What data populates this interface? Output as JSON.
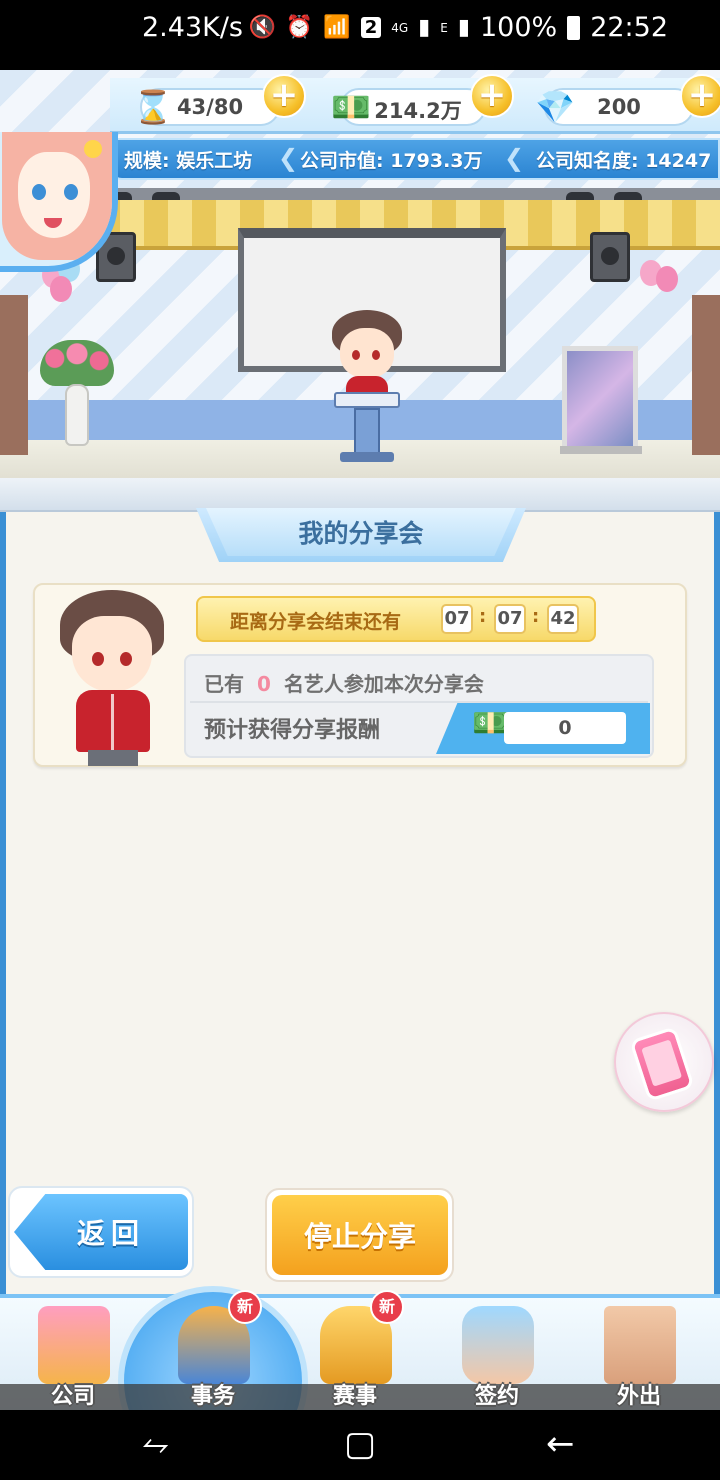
{
  "status_bar": {
    "speed": "2.43K/s",
    "sim_badge": "2",
    "net1": "4G",
    "net2": "E",
    "battery": "100%",
    "time": "22:52"
  },
  "hud": {
    "energy": "43/80",
    "cash": "214.2万",
    "gems": "200",
    "scale_label": "规模: 娱乐工坊",
    "market_value_label": "公司市值: 1793.3万",
    "fame_label": "公司知名度: 14247"
  },
  "panel": {
    "title": "我的分享会",
    "timer_label": "距离分享会结束还有",
    "timer_h": "07",
    "timer_m": "07",
    "timer_s": "42",
    "line1_prefix": "已有",
    "participants": "0",
    "line1_suffix": "名艺人参加本次分享会",
    "reward_label": "预计获得分享报酬",
    "reward_value": "0"
  },
  "buttons": {
    "back": "返回",
    "stop": "停止分享"
  },
  "bottom_nav": {
    "items": [
      {
        "label": "公司"
      },
      {
        "label": "事务",
        "badge": "新"
      },
      {
        "label": "赛事",
        "badge": "新"
      },
      {
        "label": "签约"
      },
      {
        "label": "外出"
      }
    ]
  },
  "colors": {
    "accent_blue": "#3a8fd4",
    "accent_orange": "#f4a11e",
    "badge_red": "#e83d4a"
  }
}
